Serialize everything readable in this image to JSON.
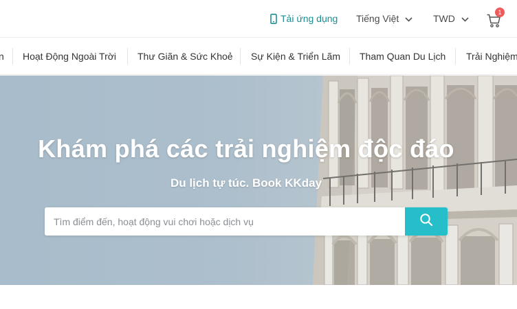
{
  "topbar": {
    "app_link_label": "Tải ứng dụng",
    "language_label": "Tiếng Việt",
    "currency_label": "TWD",
    "cart_count": "1"
  },
  "categories": [
    "n",
    "Hoạt Động Ngoài Trời",
    "Thư Giãn & Sức Khoẻ",
    "Sự Kiện & Triển Lãm",
    "Tham Quan Du Lịch",
    "Trải Nghiệm"
  ],
  "hero": {
    "title": "Khám phá các trải nghiệm độc đáo",
    "subtitle": "Du lịch tự túc. Book KKday",
    "search_placeholder": "Tìm điểm đến, hoạt động vui chơi hoặc dịch vụ"
  },
  "colors": {
    "brand_teal": "#26bec9",
    "link_teal": "#1a8f94",
    "badge_red": "#ef5b5b"
  },
  "icons": [
    "phone-icon",
    "chevron-down-icon",
    "cart-icon",
    "search-icon"
  ]
}
